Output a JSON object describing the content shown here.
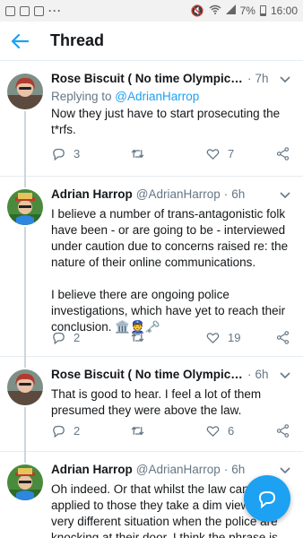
{
  "status_bar": {
    "battery": "7%",
    "time": "16:00"
  },
  "header": {
    "title": "Thread"
  },
  "tweets": [
    {
      "name": "Rose Biscuit ( No time Olympic me...",
      "handle": "",
      "time": "7h",
      "replying_prefix": "Replying to ",
      "replying_to": "@AdrianHarrop",
      "text": "Now they just have to start prosecuting the t*rfs.",
      "replies": "3",
      "retweets": "",
      "likes": "7"
    },
    {
      "name": "Adrian Harrop",
      "handle": "@AdrianHarrop",
      "time": "6h",
      "text": "I believe a number of trans-antagonistic folk have been - or are going to be - interviewed under caution due to concerns raised re: the nature of their online communications.\n\nI believe there are ongoing police investigations, which have yet to reach their conclusion. 🏛️👮🗝️",
      "replies": "2",
      "retweets": "",
      "likes": "19"
    },
    {
      "name": "Rose Biscuit ( No time Olympic me...",
      "handle": "",
      "time": "6h",
      "text": "That is good to hear. I feel a lot of them presumed they were above the law.",
      "replies": "2",
      "retweets": "",
      "likes": "6"
    },
    {
      "name": "Adrian Harrop",
      "handle": "@AdrianHarrop",
      "time": "6h",
      "text": "Oh indeed. Or that whilst the law can be applied to those they take a dim view of, a very different situation when the police are knocking at their door. I think the phrase is \"all"
    }
  ],
  "colors": {
    "accent": "#1da1f2",
    "muted": "#657786",
    "text": "#14171a"
  },
  "icons": {
    "back": "arrow-left-icon",
    "reply": "reply-icon",
    "retweet": "retweet-icon",
    "like": "heart-icon",
    "share": "share-icon",
    "more": "chevron-down-icon",
    "compose": "compose-reply-icon"
  }
}
